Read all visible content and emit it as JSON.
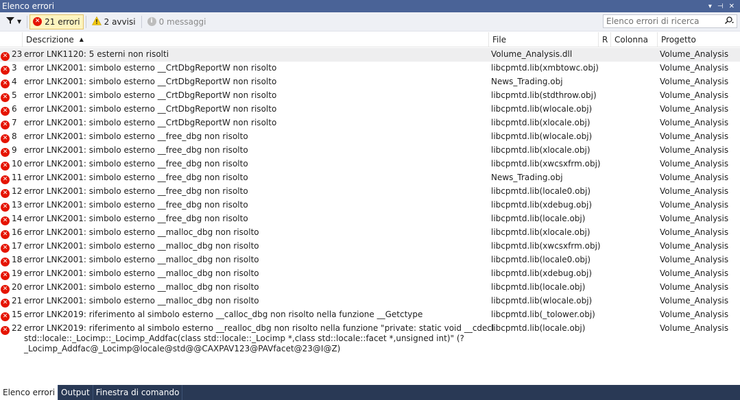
{
  "window": {
    "title": "Elenco errori",
    "controls": [
      "▾",
      "⊣",
      "✕"
    ]
  },
  "toolbar": {
    "errors_label": "21 errori",
    "warnings_label": "2 avvisi",
    "messages_label": "0 messaggi",
    "search_placeholder": "Elenco errori di ricerca"
  },
  "columns": {
    "description": "Descrizione",
    "file": "File",
    "r": "R",
    "column": "Colonna",
    "project": "Progetto"
  },
  "rows": [
    {
      "num": "23",
      "desc": [
        "error LNK1120: 5 esterni non risolti"
      ],
      "file": "Volume_Analysis.dll",
      "project": "Volume_Analysis"
    },
    {
      "num": "3",
      "desc": [
        "error LNK2001: simbolo esterno __CrtDbgReportW non risolto"
      ],
      "file": "libcpmtd.lib(xmbtowc.obj)",
      "project": "Volume_Analysis"
    },
    {
      "num": "4",
      "desc": [
        "error LNK2001: simbolo esterno __CrtDbgReportW non risolto"
      ],
      "file": "News_Trading.obj",
      "project": "Volume_Analysis"
    },
    {
      "num": "5",
      "desc": [
        "error LNK2001: simbolo esterno __CrtDbgReportW non risolto"
      ],
      "file": "libcpmtd.lib(stdthrow.obj)",
      "project": "Volume_Analysis"
    },
    {
      "num": "6",
      "desc": [
        "error LNK2001: simbolo esterno __CrtDbgReportW non risolto"
      ],
      "file": "libcpmtd.lib(wlocale.obj)",
      "project": "Volume_Analysis"
    },
    {
      "num": "7",
      "desc": [
        "error LNK2001: simbolo esterno __CrtDbgReportW non risolto"
      ],
      "file": "libcpmtd.lib(xlocale.obj)",
      "project": "Volume_Analysis"
    },
    {
      "num": "8",
      "desc": [
        "error LNK2001: simbolo esterno __free_dbg non risolto"
      ],
      "file": "libcpmtd.lib(wlocale.obj)",
      "project": "Volume_Analysis"
    },
    {
      "num": "9",
      "desc": [
        "error LNK2001: simbolo esterno __free_dbg non risolto"
      ],
      "file": "libcpmtd.lib(xlocale.obj)",
      "project": "Volume_Analysis"
    },
    {
      "num": "10",
      "desc": [
        "error LNK2001: simbolo esterno __free_dbg non risolto"
      ],
      "file": "libcpmtd.lib(xwcsxfrm.obj)",
      "project": "Volume_Analysis"
    },
    {
      "num": "11",
      "desc": [
        "error LNK2001: simbolo esterno __free_dbg non risolto"
      ],
      "file": "News_Trading.obj",
      "project": "Volume_Analysis"
    },
    {
      "num": "12",
      "desc": [
        "error LNK2001: simbolo esterno __free_dbg non risolto"
      ],
      "file": "libcpmtd.lib(locale0.obj)",
      "project": "Volume_Analysis"
    },
    {
      "num": "13",
      "desc": [
        "error LNK2001: simbolo esterno __free_dbg non risolto"
      ],
      "file": "libcpmtd.lib(xdebug.obj)",
      "project": "Volume_Analysis"
    },
    {
      "num": "14",
      "desc": [
        "error LNK2001: simbolo esterno __free_dbg non risolto"
      ],
      "file": "libcpmtd.lib(locale.obj)",
      "project": "Volume_Analysis"
    },
    {
      "num": "16",
      "desc": [
        "error LNK2001: simbolo esterno __malloc_dbg non risolto"
      ],
      "file": "libcpmtd.lib(xlocale.obj)",
      "project": "Volume_Analysis"
    },
    {
      "num": "17",
      "desc": [
        "error LNK2001: simbolo esterno __malloc_dbg non risolto"
      ],
      "file": "libcpmtd.lib(xwcsxfrm.obj)",
      "project": "Volume_Analysis"
    },
    {
      "num": "18",
      "desc": [
        "error LNK2001: simbolo esterno __malloc_dbg non risolto"
      ],
      "file": "libcpmtd.lib(locale0.obj)",
      "project": "Volume_Analysis"
    },
    {
      "num": "19",
      "desc": [
        "error LNK2001: simbolo esterno __malloc_dbg non risolto"
      ],
      "file": "libcpmtd.lib(xdebug.obj)",
      "project": "Volume_Analysis"
    },
    {
      "num": "20",
      "desc": [
        "error LNK2001: simbolo esterno __malloc_dbg non risolto"
      ],
      "file": "libcpmtd.lib(locale.obj)",
      "project": "Volume_Analysis"
    },
    {
      "num": "21",
      "desc": [
        "error LNK2001: simbolo esterno __malloc_dbg non risolto"
      ],
      "file": "libcpmtd.lib(wlocale.obj)",
      "project": "Volume_Analysis"
    },
    {
      "num": "15",
      "desc": [
        "error LNK2019: riferimento al simbolo esterno __calloc_dbg non risolto nella funzione __Getctype"
      ],
      "file": "libcpmtd.lib(_tolower.obj)",
      "project": "Volume_Analysis"
    },
    {
      "num": "22",
      "desc": [
        "error LNK2019: riferimento al simbolo esterno __realloc_dbg non risolto nella funzione \"private: static void __cdecl",
        "std::locale::_Locimp::_Locimp_Addfac(class std::locale::_Locimp *,class std::locale::facet *,unsigned int)\" (?",
        "_Locimp_Addfac@_Locimp@locale@std@@CAXPAV123@PAVfacet@23@I@Z)"
      ],
      "file": "libcpmtd.lib(locale.obj)",
      "project": "Volume_Analysis"
    }
  ],
  "tabs": [
    "Elenco errori",
    "Output",
    "Finestra di comando"
  ]
}
